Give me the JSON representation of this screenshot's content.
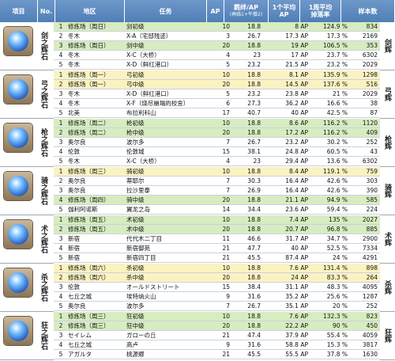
{
  "header": {
    "item": "项目",
    "no": "No.",
    "area": "地区",
    "task": "任务",
    "ap": "AP",
    "bond": "羁绊/AP",
    "bond_sub": "(再临1+午餐2)",
    "avg": "1个平均",
    "avg2": "AP",
    "drop": "1周平均",
    "drop2": "掉落率",
    "n": "样本数"
  },
  "colors": {
    "green": "#d7ecc0",
    "yellow": "#fbf2c2",
    "header": "#5f8bc1"
  },
  "groups": [
    {
      "name": "剑之辉石",
      "side": "剑辉",
      "rows": [
        {
          "no": "1",
          "area": "修炼场（周日）",
          "task": "剑初级",
          "ap": "10",
          "bond": "18.8",
          "avg": "8 AP",
          "drop": "124.9 %",
          "n": "834",
          "bg": "green"
        },
        {
          "no": "2",
          "area": "冬木",
          "task": "X-A（宅邸残迹）",
          "ap": "3",
          "bond": "26.7",
          "avg": "17.3 AP",
          "drop": "17.3 %",
          "n": "2169",
          "bg": "white"
        },
        {
          "no": "3",
          "area": "修炼场（周日）",
          "task": "剑中级",
          "ap": "20",
          "bond": "18.8",
          "avg": "19 AP",
          "drop": "106.5 %",
          "n": "353",
          "bg": "green"
        },
        {
          "no": "4",
          "area": "冬木",
          "task": "X-C（大桥）",
          "ap": "4",
          "bond": "23",
          "avg": "17 AP",
          "drop": "23.7 %",
          "n": "6302",
          "bg": "white"
        },
        {
          "no": "5",
          "area": "冬木",
          "task": "X-D（鲜红港口）",
          "ap": "5",
          "bond": "23.2",
          "avg": "21.5 AP",
          "drop": "23.2 %",
          "n": "2029",
          "bg": "white"
        }
      ]
    },
    {
      "name": "弓之辉石",
      "side": "弓辉",
      "rows": [
        {
          "no": "1",
          "area": "修炼场（周一）",
          "task": "弓初级",
          "ap": "10",
          "bond": "18.8",
          "avg": "8.1 AP",
          "drop": "135.9 %",
          "n": "1298",
          "bg": "yellow"
        },
        {
          "no": "2",
          "area": "修炼场（周一）",
          "task": "弓中级",
          "ap": "20",
          "bond": "18.8",
          "avg": "14.5 AP",
          "drop": "137.6 %",
          "n": "516",
          "bg": "yellow"
        },
        {
          "no": "3",
          "area": "冬木",
          "task": "X-D（鲜红港口）",
          "ap": "5",
          "bond": "23.2",
          "avg": "23.8 AP",
          "drop": "21 %",
          "n": "2029",
          "bg": "white"
        },
        {
          "no": "4",
          "area": "冬木",
          "task": "X-F（烧尽崩塌的校舍）",
          "ap": "6",
          "bond": "27.3",
          "avg": "36.2 AP",
          "drop": "16.6 %",
          "n": "38",
          "bg": "white"
        },
        {
          "no": "5",
          "area": "北美",
          "task": "布拉利科山",
          "ap": "17",
          "bond": "40.7",
          "avg": "40 AP",
          "drop": "42.5 %",
          "n": "87",
          "bg": "white"
        }
      ]
    },
    {
      "name": "枪之辉石",
      "side": "枪辉",
      "rows": [
        {
          "no": "1",
          "area": "修炼场（周二）",
          "task": "枪初级",
          "ap": "10",
          "bond": "18.8",
          "avg": "8.6 AP",
          "drop": "116.2 %",
          "n": "1120",
          "bg": "green"
        },
        {
          "no": "2",
          "area": "修炼场（周二）",
          "task": "枪中级",
          "ap": "20",
          "bond": "18.8",
          "avg": "17.2 AP",
          "drop": "116.2 %",
          "n": "409",
          "bg": "green"
        },
        {
          "no": "3",
          "area": "奥尔良",
          "task": "波尔多",
          "ap": "7",
          "bond": "26.7",
          "avg": "23.2 AP",
          "drop": "30.2 %",
          "n": "252",
          "bg": "white"
        },
        {
          "no": "4",
          "area": "伦敦",
          "task": "伦敦城",
          "ap": "15",
          "bond": "38.1",
          "avg": "24.8 AP",
          "drop": "60.5 %",
          "n": "43",
          "bg": "white"
        },
        {
          "no": "5",
          "area": "冬木",
          "task": "X-C（大桥）",
          "ap": "4",
          "bond": "23",
          "avg": "29.4 AP",
          "drop": "13.6 %",
          "n": "6302",
          "bg": "white"
        }
      ]
    },
    {
      "name": "骑之辉石",
      "side": "骑辉",
      "rows": [
        {
          "no": "1",
          "area": "修炼场（周三）",
          "task": "骑初级",
          "ap": "10",
          "bond": "18.8",
          "avg": "8.4 AP",
          "drop": "119.1 %",
          "n": "759",
          "bg": "yellow"
        },
        {
          "no": "2",
          "area": "奥尔良",
          "task": "蒂耶尔",
          "ap": "7",
          "bond": "30.3",
          "avg": "16.4 AP",
          "drop": "42.6 %",
          "n": "303",
          "bg": "white"
        },
        {
          "no": "3",
          "area": "奥尔良",
          "task": "拉沙里泰",
          "ap": "7",
          "bond": "26.9",
          "avg": "16.4 AP",
          "drop": "42.6 %",
          "n": "390",
          "bg": "white"
        },
        {
          "no": "4",
          "area": "修炼场（周四）",
          "task": "骑中级",
          "ap": "20",
          "bond": "18.8",
          "avg": "21.1 AP",
          "drop": "94.9 %",
          "n": "585",
          "bg": "green"
        },
        {
          "no": "5",
          "area": "伽利阿诺斯",
          "task": "翼龙之岛",
          "ap": "14",
          "bond": "34.4",
          "avg": "23.6 AP",
          "drop": "59.4 %",
          "n": "224",
          "bg": "white"
        }
      ]
    },
    {
      "name": "术之辉石",
      "side": "术辉",
      "rows": [
        {
          "no": "1",
          "area": "修炼场（周五）",
          "task": "术初级",
          "ap": "10",
          "bond": "18.8",
          "avg": "7.4 AP",
          "drop": "135 %",
          "n": "2027",
          "bg": "green"
        },
        {
          "no": "2",
          "area": "修炼场（周五）",
          "task": "术中级",
          "ap": "20",
          "bond": "18.8",
          "avg": "20.7 AP",
          "drop": "96.8 %",
          "n": "885",
          "bg": "green"
        },
        {
          "no": "3",
          "area": "新宿",
          "task": "代代木二丁目",
          "ap": "11",
          "bond": "46.6",
          "avg": "31.7 AP",
          "drop": "34.7 %",
          "n": "2900",
          "bg": "white"
        },
        {
          "no": "4",
          "area": "新宿",
          "task": "新宿御苑",
          "ap": "21",
          "bond": "47.7",
          "avg": "40 AP",
          "drop": "52.5 %",
          "n": "7334",
          "bg": "white"
        },
        {
          "no": "5",
          "area": "新宿",
          "task": "新宿四丁目",
          "ap": "21",
          "bond": "45.5",
          "avg": "87.4 AP",
          "drop": "24 %",
          "n": "4291",
          "bg": "white"
        }
      ]
    },
    {
      "name": "杀之辉石",
      "side": "杀辉",
      "rows": [
        {
          "no": "1",
          "area": "修炼场（周六）",
          "task": "杀初级",
          "ap": "10",
          "bond": "18.8",
          "avg": "7.6 AP",
          "drop": "131.4 %",
          "n": "898",
          "bg": "yellow"
        },
        {
          "no": "2",
          "area": "修炼场（周六）",
          "task": "杀中级",
          "ap": "20",
          "bond": "18.8",
          "avg": "24 AP",
          "drop": "83.3 %",
          "n": "264",
          "bg": "yellow"
        },
        {
          "no": "3",
          "area": "伦敦",
          "task": "オールドストリート",
          "ap": "15",
          "bond": "38.4",
          "avg": "31.1 AP",
          "drop": "48.3 %",
          "n": "4095",
          "bg": "white"
        },
        {
          "no": "4",
          "area": "七丘之城",
          "task": "埃特纳火山",
          "ap": "9",
          "bond": "31.6",
          "avg": "35.2 AP",
          "drop": "25.6 %",
          "n": "1287",
          "bg": "white"
        },
        {
          "no": "5",
          "area": "奥尔良",
          "task": "波尔多",
          "ap": "7",
          "bond": "26.7",
          "avg": "35.1 AP",
          "drop": "20 %",
          "n": "252",
          "bg": "white"
        }
      ]
    },
    {
      "name": "狂之辉石",
      "side": "狂辉",
      "rows": [
        {
          "no": "1",
          "area": "修炼场（周三）",
          "task": "狂初级",
          "ap": "10",
          "bond": "18.8",
          "avg": "7.6 AP",
          "drop": "132.3 %",
          "n": "823",
          "bg": "green"
        },
        {
          "no": "2",
          "area": "修炼场（周三）",
          "task": "狂中级",
          "ap": "20",
          "bond": "18.8",
          "avg": "22.2 AP",
          "drop": "90 %",
          "n": "450",
          "bg": "green"
        },
        {
          "no": "3",
          "area": "セイレム",
          "task": "ガローの丘",
          "ap": "21",
          "bond": "47.4",
          "avg": "37.9 AP",
          "drop": "55.4 %",
          "n": "4059",
          "bg": "white"
        },
        {
          "no": "4",
          "area": "七丘之城",
          "task": "高卢",
          "ap": "9",
          "bond": "31.6",
          "avg": "58.8 AP",
          "drop": "15.3 %",
          "n": "3817",
          "bg": "white"
        },
        {
          "no": "5",
          "area": "アガルタ",
          "task": "桃源郷",
          "ap": "21",
          "bond": "45.5",
          "avg": "55.5 AP",
          "drop": "37.8 %",
          "n": "1630",
          "bg": "white"
        }
      ]
    }
  ]
}
